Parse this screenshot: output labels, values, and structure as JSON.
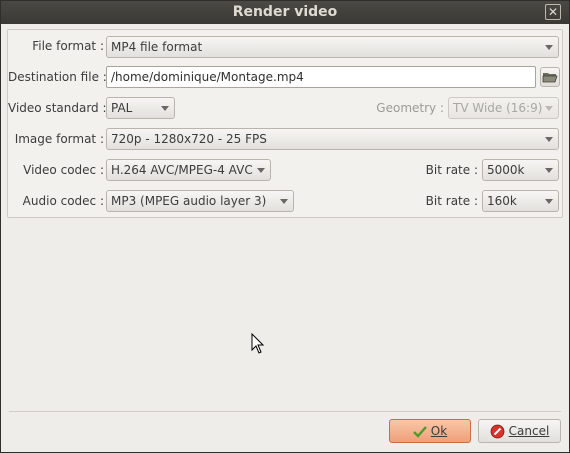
{
  "window": {
    "title": "Render video",
    "close_glyph": "✕"
  },
  "form": {
    "file_format": {
      "label": "File format :",
      "value": "MP4 file format"
    },
    "destination": {
      "label": "Destination file :",
      "value": "/home/dominique/Montage.mp4",
      "browse_icon": "folder-open-icon"
    },
    "video_standard": {
      "label": "Video standard :",
      "value": "PAL"
    },
    "geometry": {
      "label": "Geometry :",
      "value": "TV Wide (16:9)",
      "disabled": true
    },
    "image_format": {
      "label": "Image format :",
      "value": "720p - 1280x720 - 25 FPS"
    },
    "video_codec": {
      "label": "Video codec :",
      "value": "H.264 AVC/MPEG-4 AVC"
    },
    "video_bitrate": {
      "label": "Bit rate :",
      "value": "5000k"
    },
    "audio_codec": {
      "label": "Audio codec :",
      "value": "MP3 (MPEG audio layer 3)"
    },
    "audio_bitrate": {
      "label": "Bit rate :",
      "value": "160k"
    }
  },
  "buttons": {
    "ok": {
      "label": "Ok",
      "icon": "checkmark-icon",
      "accent": "#ef9f79"
    },
    "cancel": {
      "label": "Cancel",
      "icon": "cancel-icon"
    }
  }
}
